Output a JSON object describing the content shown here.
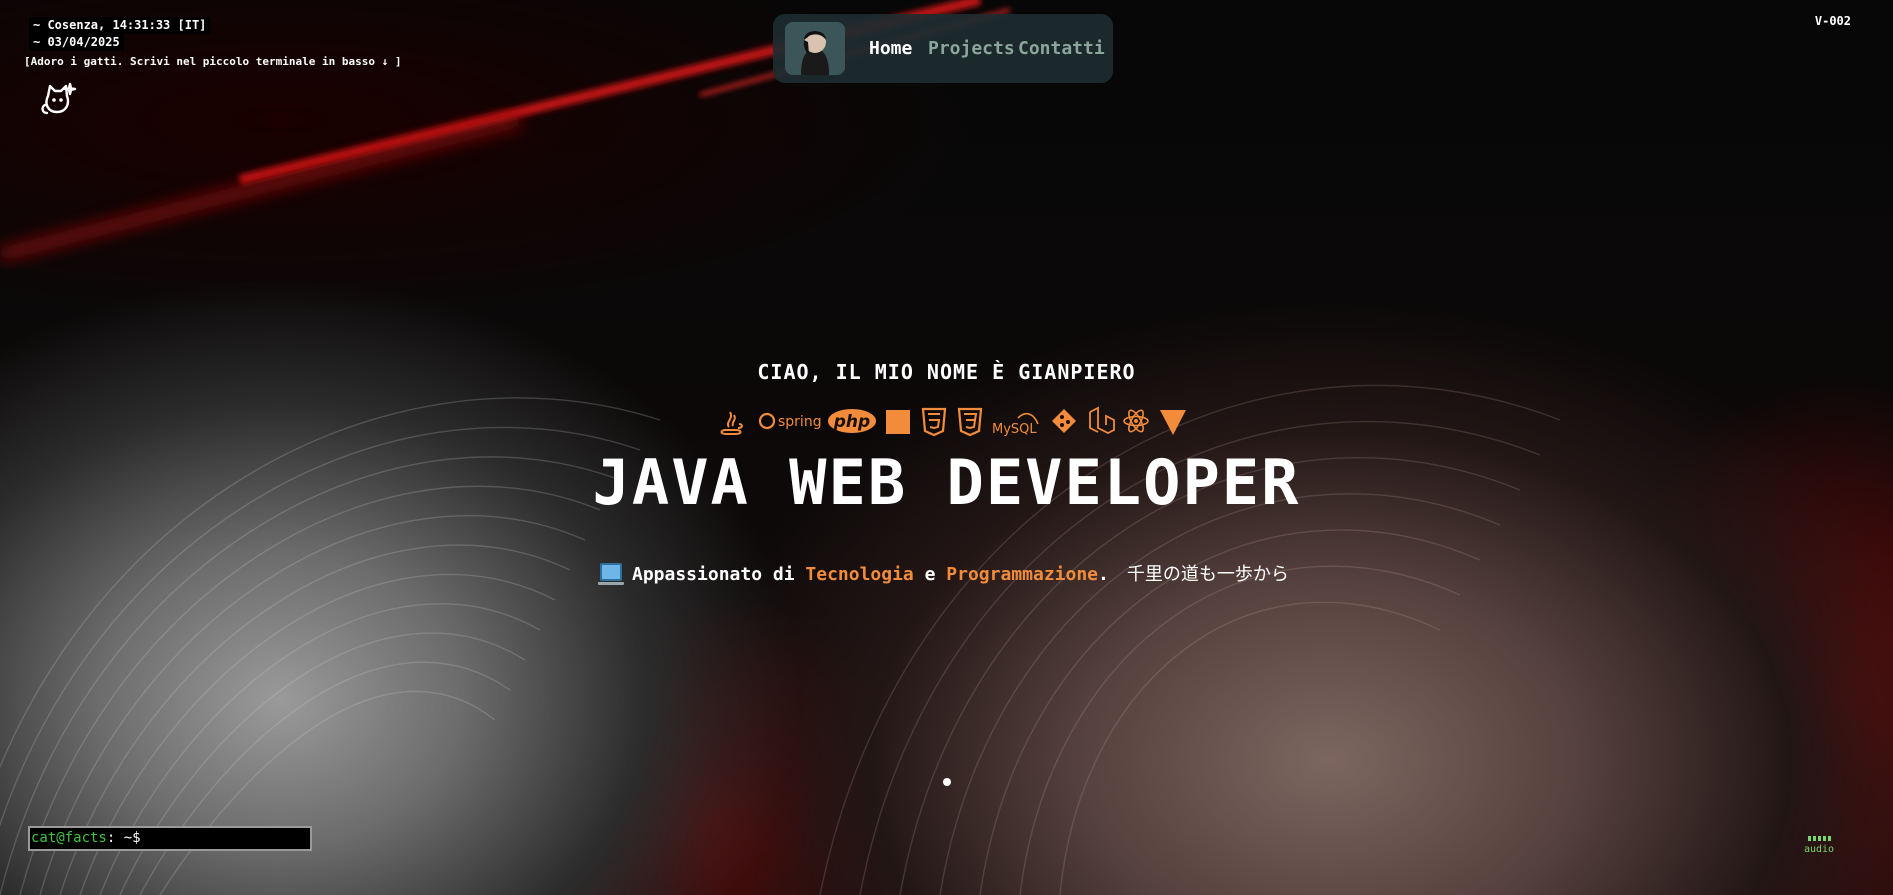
{
  "hud": {
    "location": "~ Cosenza, 14:31:33 [IT]",
    "date": "~ 03/04/2025",
    "cat_note": "[Adoro i gatti. Scrivi nel piccolo terminale in basso ↓ ]",
    "version": "V-002"
  },
  "nav": {
    "home": "Home",
    "projects": "Projects",
    "contatti": "Contatti"
  },
  "hero": {
    "greeting": "CIAO, IL MIO NOME È GIANPIERO",
    "headline": "JAVA WEB DEVELOPER",
    "tagline_prefix": "Appassionato di ",
    "tagline_accent1": "Tecnologia",
    "tagline_and": " e ",
    "tagline_accent2": "Programmazione",
    "tagline_dot": ".",
    "tagline_japanese": "千里の道も一歩から",
    "tech_icons": [
      "java-icon",
      "spring-icon",
      "php-icon",
      "square-icon",
      "html5-icon",
      "css3-icon",
      "mysql-icon",
      "git-icon",
      "laravel-icon",
      "react-icon",
      "vite-icon"
    ],
    "tech_labels": {
      "spring": "spring",
      "php": "php",
      "mysql": "MySQL"
    }
  },
  "terminal": {
    "user": "cat@facts",
    "prompt": ": ~$"
  },
  "audio": {
    "label": "audio"
  },
  "colors": {
    "accent": "#f28c3a",
    "nav_active": "#ffffff",
    "nav_inactive": "#8aa59a",
    "terminal_user": "#3ec43e"
  }
}
